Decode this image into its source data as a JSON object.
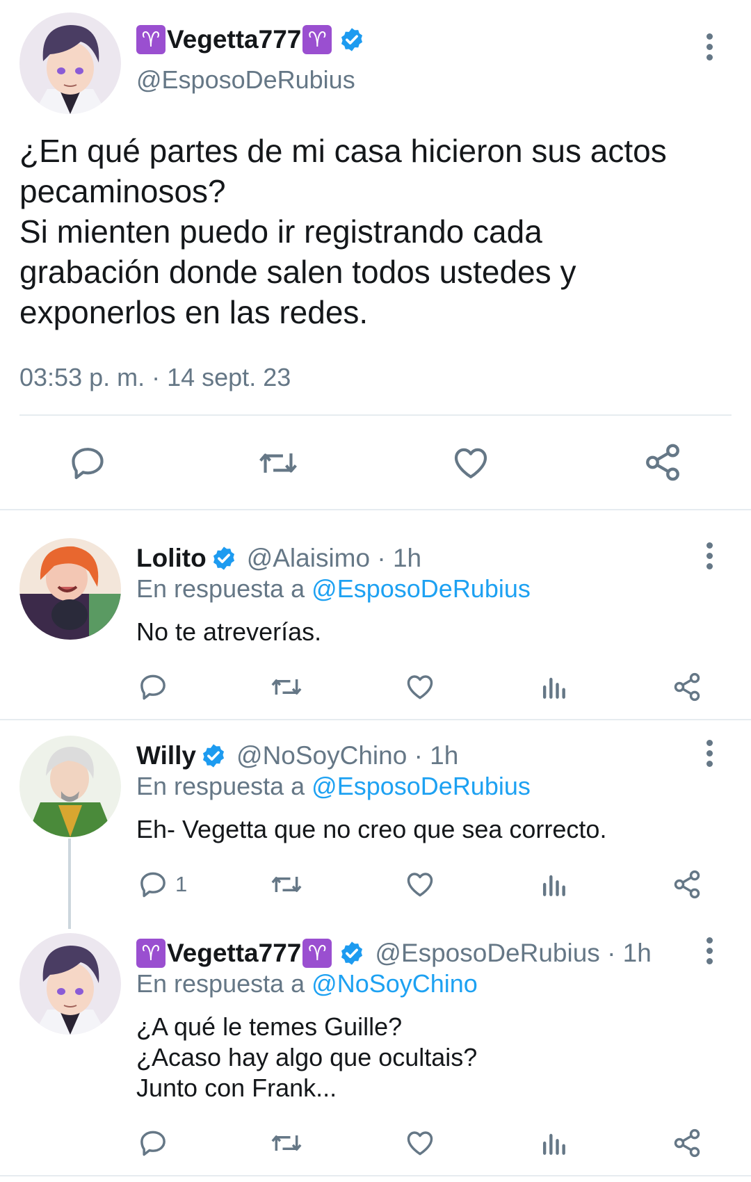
{
  "main_tweet": {
    "display_name": "Vegetta777",
    "handle": "@EsposoDeRubius",
    "text_lines": [
      "¿En qué partes de mi casa hicieron sus actos",
      "pecaminosos?",
      "Si mienten puedo ir registrando cada",
      "grabación donde salen todos ustedes y",
      "exponerlos en las redes."
    ],
    "timestamp": "03:53 p. m. · 14 sept. 23"
  },
  "replies": [
    {
      "display_name": "Lolito",
      "handle_time": "@Alaisimo · 1h",
      "reply_prefix": "En respuesta a ",
      "reply_to": "@EsposoDeRubius",
      "text_lines": [
        "No te atreverías."
      ],
      "reply_count": ""
    },
    {
      "display_name": "Willy",
      "handle_time": "@NoSoyChino · 1h",
      "reply_prefix": "En respuesta a ",
      "reply_to": "@EsposoDeRubius",
      "text_lines": [
        "Eh- Vegetta que no creo que sea correcto."
      ],
      "reply_count": "1"
    },
    {
      "display_name": "Vegetta777",
      "handle_time": "@EsposoDeRubius · 1h",
      "reply_prefix": "En respuesta a ",
      "reply_to": "@NoSoyChino",
      "text_lines": [
        "¿A qué le temes Guille?",
        "¿Acaso hay algo que ocultais?",
        "Junto con Frank..."
      ],
      "reply_count": ""
    }
  ],
  "emoji": {
    "aries": "♈"
  },
  "icons": [
    "reply-icon",
    "retweet-icon",
    "like-icon",
    "analytics-icon",
    "share-icon",
    "verified-badge-icon",
    "more-options-icon"
  ],
  "colors": {
    "link": "#1da1f2",
    "muted": "#657786",
    "aries_bg": "#9a4fd0",
    "verified": "#1d9bf0"
  }
}
